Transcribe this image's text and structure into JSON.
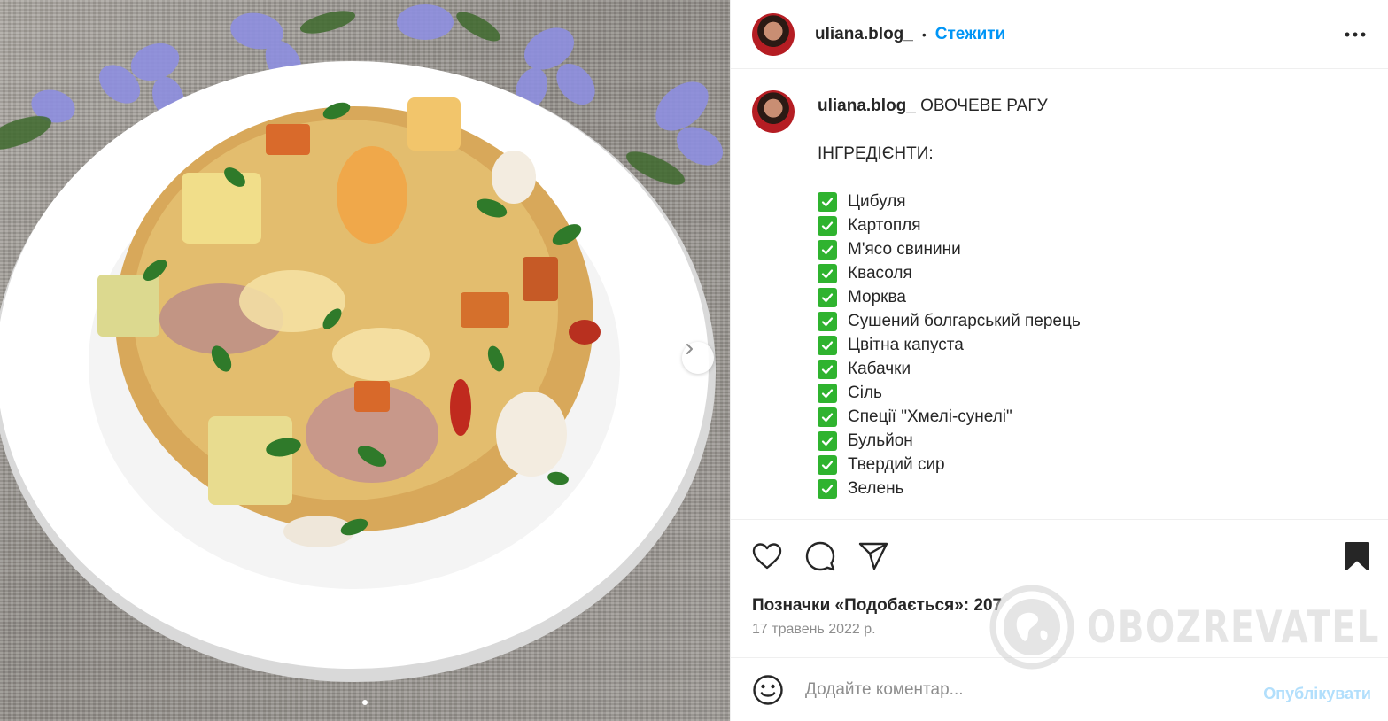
{
  "post": {
    "username": "uliana.blog_",
    "separator": "•",
    "follow_label": "Стежити",
    "caption": {
      "username": "uliana.blog_",
      "title": "ОВОЧЕВЕ РАГУ",
      "ingredients_heading": "ІНГРЕДІЄНТИ:",
      "ingredients": [
        "Цибуля",
        "Картопля",
        "М'ясо свинини",
        "Квасоля",
        "Морква",
        "Сушений болгарський перець",
        "Цвітна капуста",
        "Кабачки",
        "Сіль",
        "Спеції \"Хмелі-сунелі\"",
        "Бульйон",
        "Твердий сир",
        "Зелень"
      ]
    },
    "likes_text": "Позначки «Подобається»: 207",
    "date": "17 травень 2022 р.",
    "comment": {
      "placeholder": "Додайте коментар...",
      "publish_label": "Опублікувати"
    },
    "carousel": {
      "current": 1,
      "total": 1
    }
  },
  "watermark": {
    "text": "OBOZREVATEL"
  },
  "colors": {
    "accent": "#0095f6",
    "publish_disabled": "#b2dffc",
    "check": "#2fb32f"
  },
  "icons": [
    "heart-icon",
    "comment-icon",
    "share-icon",
    "bookmark-icon",
    "more-icon",
    "emoji-icon",
    "chevron-right-icon"
  ]
}
